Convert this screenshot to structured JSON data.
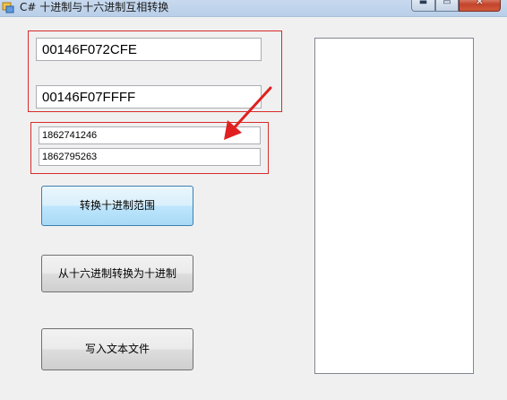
{
  "window": {
    "title": "C# 十进制与十六进制互相转换",
    "caption_buttons": {
      "minimize": "▬",
      "maximize": "▭",
      "close": "✕"
    }
  },
  "hex_inputs": {
    "start_value": "00146F072CFE",
    "end_value": "00146F07FFFF"
  },
  "decimal_inputs": {
    "start_value": "1862741246",
    "end_value": "1862795263"
  },
  "buttons": {
    "convert_range": "转换十进制范围",
    "hex_to_decimal": "从十六进制转换为十进制",
    "write_file": "写入文本文件"
  },
  "annotation": {
    "color": "#d92a2a"
  },
  "icons": {
    "app": "windows-form-icon",
    "arrow": "red-arrow-icon"
  }
}
